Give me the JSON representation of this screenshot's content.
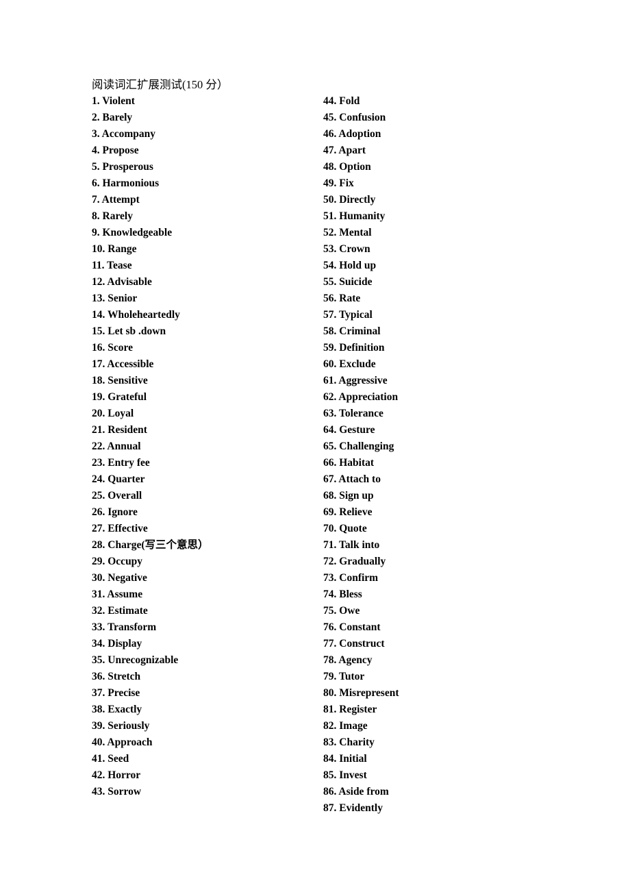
{
  "document": {
    "title": "阅读词汇扩展测试(150 分）",
    "background_color": "#ffffff",
    "text_color": "#000000"
  },
  "columns": {
    "left": {
      "name": "items-1-43",
      "items": [
        {
          "number": "1.",
          "term": "Violent"
        },
        {
          "number": "2.",
          "term": "Barely"
        },
        {
          "number": "3.",
          "term": "Accompany"
        },
        {
          "number": "4.",
          "term": "Propose"
        },
        {
          "number": "5.",
          "term": "Prosperous"
        },
        {
          "number": "6.",
          "term": "Harmonious"
        },
        {
          "number": "7.",
          "term": "Attempt"
        },
        {
          "number": "8.",
          "term": "Rarely"
        },
        {
          "number": "9.",
          "term": "Knowledgeable"
        },
        {
          "number": "10.",
          "term": "Range"
        },
        {
          "number": "11.",
          "term": "Tease"
        },
        {
          "number": "12.",
          "term": "Advisable"
        },
        {
          "number": "13.",
          "term": "Senior"
        },
        {
          "number": "14.",
          "term": "Wholeheartedly"
        },
        {
          "number": "15.",
          "term": "Let sb .down"
        },
        {
          "number": "16.",
          "term": "Score"
        },
        {
          "number": "17.",
          "term": "Accessible"
        },
        {
          "number": "18.",
          "term": "Sensitive"
        },
        {
          "number": "19.",
          "term": "Grateful"
        },
        {
          "number": "20.",
          "term": "Loyal"
        },
        {
          "number": "21.",
          "term": "Resident"
        },
        {
          "number": "22.",
          "term": "Annual"
        },
        {
          "number": "23.",
          "term": "Entry fee"
        },
        {
          "number": "24.",
          "term": "Quarter"
        },
        {
          "number": "25.",
          "term": "Overall"
        },
        {
          "number": "26.",
          "term": "Ignore"
        },
        {
          "number": "27.",
          "term": "Effective"
        },
        {
          "number": "28.",
          "term": "Charge(写三个意思）"
        },
        {
          "number": "29.",
          "term": "Occupy"
        },
        {
          "number": "30.",
          "term": "Negative"
        },
        {
          "number": "31.",
          "term": "Assume"
        },
        {
          "number": "32.",
          "term": "Estimate"
        },
        {
          "number": "33.",
          "term": "Transform"
        },
        {
          "number": "34.",
          "term": "Display"
        },
        {
          "number": "35.",
          "term": "Unrecognizable"
        },
        {
          "number": "36.",
          "term": "Stretch"
        },
        {
          "number": "37.",
          "term": "Precise"
        },
        {
          "number": "38.",
          "term": "Exactly"
        },
        {
          "number": "39.",
          "term": "Seriously"
        },
        {
          "number": "40.",
          "term": "Approach"
        },
        {
          "number": "41.",
          "term": "Seed"
        },
        {
          "number": "42.",
          "term": "Horror"
        },
        {
          "number": "43.",
          "term": "Sorrow"
        }
      ]
    },
    "right": {
      "name": "items-44-87",
      "items": [
        {
          "number": "44.",
          "term": "Fold"
        },
        {
          "number": "45.",
          "term": "Confusion"
        },
        {
          "number": "46.",
          "term": "Adoption"
        },
        {
          "number": "47.",
          "term": "Apart"
        },
        {
          "number": "48.",
          "term": "Option"
        },
        {
          "number": "49.",
          "term": "Fix"
        },
        {
          "number": "50.",
          "term": "Directly"
        },
        {
          "number": "51.",
          "term": "Humanity"
        },
        {
          "number": "52.",
          "term": "Mental"
        },
        {
          "number": "53.",
          "term": "Crown"
        },
        {
          "number": "54.",
          "term": "Hold up"
        },
        {
          "number": "55.",
          "term": "Suicide"
        },
        {
          "number": "56.",
          "term": "Rate"
        },
        {
          "number": "57.",
          "term": "Typical"
        },
        {
          "number": "58.",
          "term": "Criminal"
        },
        {
          "number": "59.",
          "term": "Definition"
        },
        {
          "number": "60.",
          "term": "Exclude"
        },
        {
          "number": "61.",
          "term": "Aggressive"
        },
        {
          "number": "62.",
          "term": "Appreciation"
        },
        {
          "number": "63.",
          "term": "Tolerance"
        },
        {
          "number": "64.",
          "term": "Gesture"
        },
        {
          "number": "65.",
          "term": "Challenging"
        },
        {
          "number": "66.",
          "term": "Habitat"
        },
        {
          "number": "67.",
          "term": "Attach to"
        },
        {
          "number": "68.",
          "term": "Sign up"
        },
        {
          "number": "69.",
          "term": "Relieve"
        },
        {
          "number": "70.",
          "term": "Quote"
        },
        {
          "number": "71.",
          "term": "Talk into"
        },
        {
          "number": "72.",
          "term": "Gradually"
        },
        {
          "number": "73.",
          "term": "Confirm"
        },
        {
          "number": "74.",
          "term": "Bless"
        },
        {
          "number": "75.",
          "term": "Owe"
        },
        {
          "number": "76.",
          "term": "Constant"
        },
        {
          "number": "77.",
          "term": "Construct"
        },
        {
          "number": "78.",
          "term": "Agency"
        },
        {
          "number": "79.",
          "term": "Tutor"
        },
        {
          "number": "80.",
          "term": "Misrepresent"
        },
        {
          "number": "81.",
          "term": "Register"
        },
        {
          "number": "82.",
          "term": "Image"
        },
        {
          "number": "83.",
          "term": "Charity"
        },
        {
          "number": "84.",
          "term": "Initial"
        },
        {
          "number": "85.",
          "term": "Invest"
        },
        {
          "number": "86.",
          "term": "Aside from"
        },
        {
          "number": "87.",
          "term": "Evidently"
        }
      ]
    }
  }
}
